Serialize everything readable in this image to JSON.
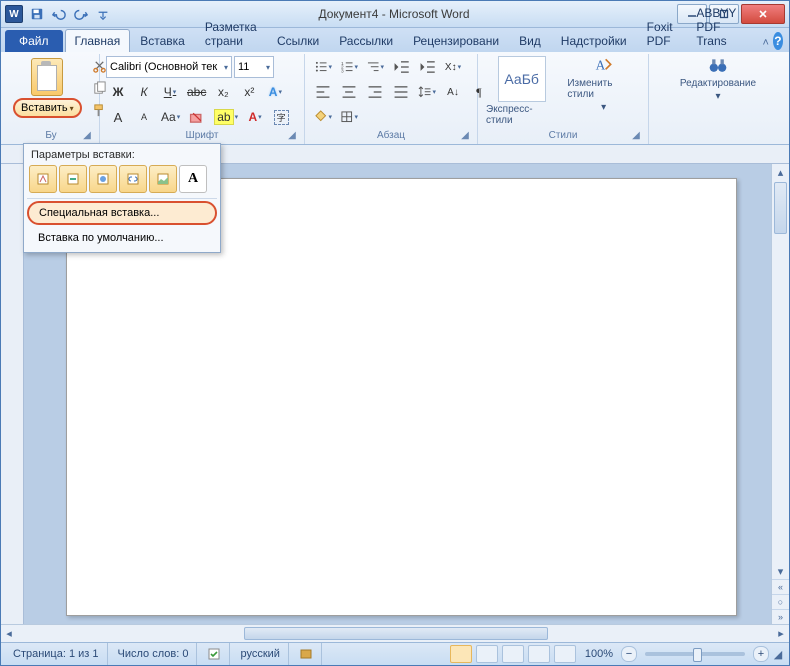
{
  "app_icon_letter": "W",
  "title": "Документ4 - Microsoft Word",
  "window_controls": {
    "min": "_",
    "max": "▢",
    "close": "✕"
  },
  "qat": {
    "save": "save-icon",
    "undo": "undo-icon",
    "redo": "redo-icon",
    "qat_menu": "qat-menu"
  },
  "tabs": {
    "file": "Файл",
    "items": [
      "Главная",
      "Вставка",
      "Разметка страни",
      "Ссылки",
      "Рассылки",
      "Рецензировани",
      "Вид",
      "Надстройки",
      "Foxit PDF",
      "ABBYY PDF Trans"
    ],
    "active_index": 0,
    "minimize_ribbon": "˄",
    "help": "?"
  },
  "ribbon": {
    "clipboard": {
      "paste_label": "Вставить",
      "group_label": "Бу",
      "cut": "cut",
      "copy": "copy",
      "painter": "format-painter"
    },
    "font": {
      "font_name": "Calibri (Основной тек",
      "font_size": "11",
      "grow": "A",
      "shrink": "A",
      "case": "Aa",
      "clear": "clear",
      "bold": "Ж",
      "italic": "К",
      "underline": "Ч",
      "strike": "abc",
      "sub": "x₂",
      "sup": "x²",
      "effects": "A",
      "highlight": "ab",
      "color": "A",
      "group_label": "Шрифт"
    },
    "paragraph": {
      "group_label": "Абзац"
    },
    "styles": {
      "quick_label": "Экспресс-стили",
      "change_label": "Изменить стили",
      "group_label": "Стили",
      "preview": "АаБб"
    },
    "editing": {
      "label": "Редактирование",
      "icon": "binoculars"
    }
  },
  "paste_popup": {
    "title": "Параметры вставки:",
    "options": [
      "keep-source",
      "merge",
      "use-dest",
      "picture",
      "link",
      "text-only"
    ],
    "text_only_glyph": "A",
    "special": "Специальная вставка...",
    "default": "Вставка по умолчанию..."
  },
  "status": {
    "page": "Страница: 1 из 1",
    "words": "Число слов: 0",
    "lang": "русский",
    "zoom": "100%"
  },
  "colors": {
    "accent": "#2b579a",
    "highlight_ring": "#d9502f"
  }
}
